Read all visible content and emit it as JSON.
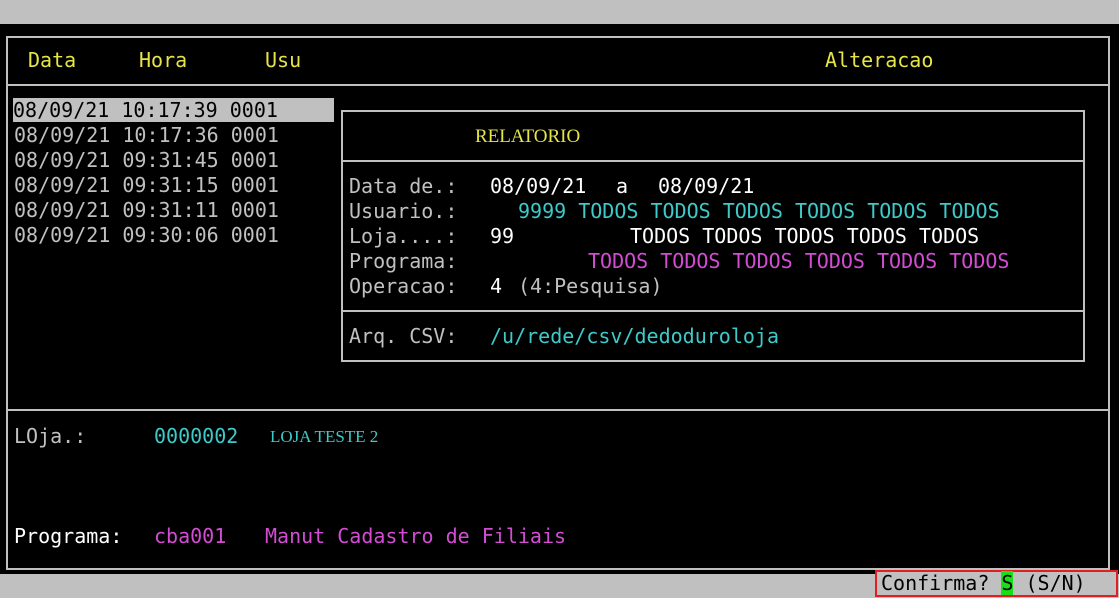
{
  "header": {
    "col_data": "Data",
    "col_hora": "Hora",
    "col_usu": "Usu",
    "col_alteracao": "Alteracao"
  },
  "log_rows": [
    {
      "data": "08/09/21",
      "hora": "10:17:39",
      "usu": "0001"
    },
    {
      "data": "08/09/21",
      "hora": "10:17:36",
      "usu": "0001"
    },
    {
      "data": "08/09/21",
      "hora": "09:31:45",
      "usu": "0001"
    },
    {
      "data": "08/09/21",
      "hora": "09:31:15",
      "usu": "0001"
    },
    {
      "data": "08/09/21",
      "hora": "09:31:11",
      "usu": "0001"
    },
    {
      "data": "08/09/21",
      "hora": "09:30:06",
      "usu": "0001"
    }
  ],
  "relatorio": {
    "title": "RELATORIO",
    "data_label": "Data de.:",
    "data_from": "08/09/21",
    "data_sep": "a",
    "data_to": "08/09/21",
    "usuario_label": "Usuario.:",
    "usuario_value": "9999 TODOS TODOS TODOS TODOS TODOS TODOS",
    "loja_label": "Loja....:",
    "loja_code": "99",
    "loja_value": "TODOS TODOS TODOS TODOS TODOS",
    "programa_label": "Programa:",
    "programa_value": "TODOS TODOS TODOS TODOS TODOS TODOS",
    "operacao_label": "Operacao:",
    "operacao_code": "4",
    "operacao_desc": "(4:Pesquisa)",
    "csv_label": "Arq. CSV:",
    "csv_path": "/u/rede/csv/dedoduroloja"
  },
  "footer": {
    "loja_label": "LOja.:",
    "loja_code": "0000002",
    "loja_name": "LOJA TESTE 2",
    "programa_label": "Programa:",
    "programa_code": "cba001",
    "programa_desc": "Manut Cadastro de Filiais"
  },
  "status": {
    "prompt": "Confirma?",
    "answer": "S",
    "options": "(S/N)"
  },
  "colors": {
    "screen_bg": "#000000",
    "border": "#c0c0c0",
    "header_text": "#e5e54a",
    "cyan": "#3fc9c9",
    "magenta": "#d34cd3",
    "answer_bg": "#18e018",
    "status_border": "#e02020"
  }
}
